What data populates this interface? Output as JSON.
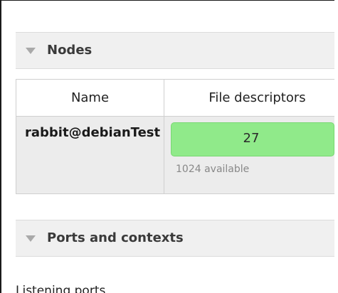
{
  "nodes_section": {
    "title": "Nodes",
    "table": {
      "headers": [
        "Name",
        "File descriptors"
      ],
      "rows": [
        {
          "name": "rabbit@debianTest",
          "file_descriptors_used": "27",
          "file_descriptors_available": "1024 available"
        }
      ]
    }
  },
  "ports_section": {
    "title": "Ports and contexts",
    "listening_label": "Listening ports"
  },
  "colors": {
    "section_header_bg": "#f0f0f0",
    "fd_bar_green": "#90ea8a",
    "row_bg": "#ececec"
  },
  "icons": {
    "section_toggle": "triangle-down-icon"
  }
}
